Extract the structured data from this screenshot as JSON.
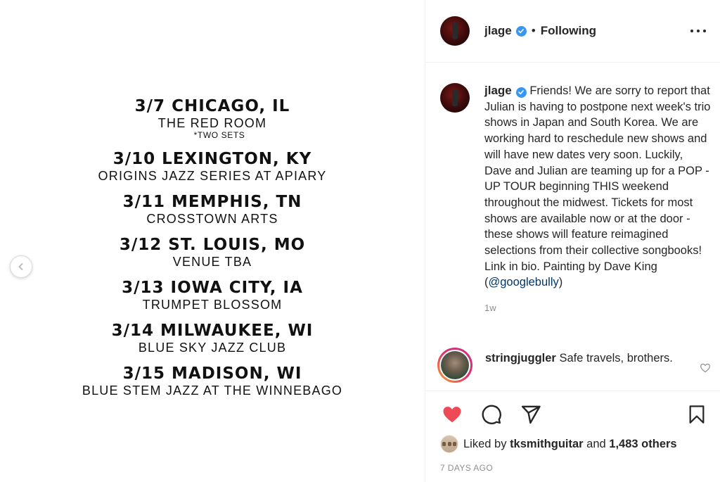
{
  "tour": [
    {
      "city": "3/7 CHICAGO, IL",
      "venue": "THE RED ROOM",
      "note": "*TWO SETS"
    },
    {
      "city": "3/10 LEXINGTON, KY",
      "venue": "ORIGINS JAZZ SERIES AT APIARY"
    },
    {
      "city": "3/11 MEMPHIS, TN",
      "venue": "CROSSTOWN ARTS"
    },
    {
      "city": "3/12 ST. LOUIS, MO",
      "venue": "VENUE TBA"
    },
    {
      "city": "3/13 IOWA CITY, IA",
      "venue": "TRUMPET BLOSSOM"
    },
    {
      "city": "3/14 MILWAUKEE, WI",
      "venue": "BLUE SKY JAZZ CLUB"
    },
    {
      "city": "3/15 MADISON, WI",
      "venue": "BLUE STEM JAZZ AT THE WINNEBAGO"
    }
  ],
  "header": {
    "username": "jlage",
    "separator": "•",
    "follow_status": "Following"
  },
  "caption": {
    "username": "jlage",
    "text": "Friends! We are sorry to report that Julian is having to postpone next week's trio shows in Japan and South Korea. We are working hard to reschedule new shows and will have new dates very soon. Luckily, Dave and Julian are teaming up for a POP - UP TOUR beginning THIS weekend throughout the midwest. Tickets for most shows are available now or at the door - these shows will feature reimagined selections from their collective songbooks! Link in bio. Painting by Dave King (",
    "mention": "@googlebully",
    "text_end": ")",
    "time_ago": "1w"
  },
  "comment": {
    "username": "stringjuggler",
    "text": "Safe travels, brothers."
  },
  "likes": {
    "prefix": "Liked by",
    "user": "tksmithguitar",
    "joiner": "and",
    "others": "1,483 others"
  },
  "date": "7 DAYS AGO",
  "colors": {
    "like_red": "#ed4956",
    "verified_blue": "#3897f0",
    "mention_blue": "#00376b",
    "muted_gray": "#8e8e8e"
  },
  "icons": [
    "chevron-left-icon",
    "verified-badge-icon",
    "more-options-icon",
    "heart-outline-icon",
    "heart-filled-icon",
    "comment-icon",
    "share-icon",
    "bookmark-icon"
  ]
}
